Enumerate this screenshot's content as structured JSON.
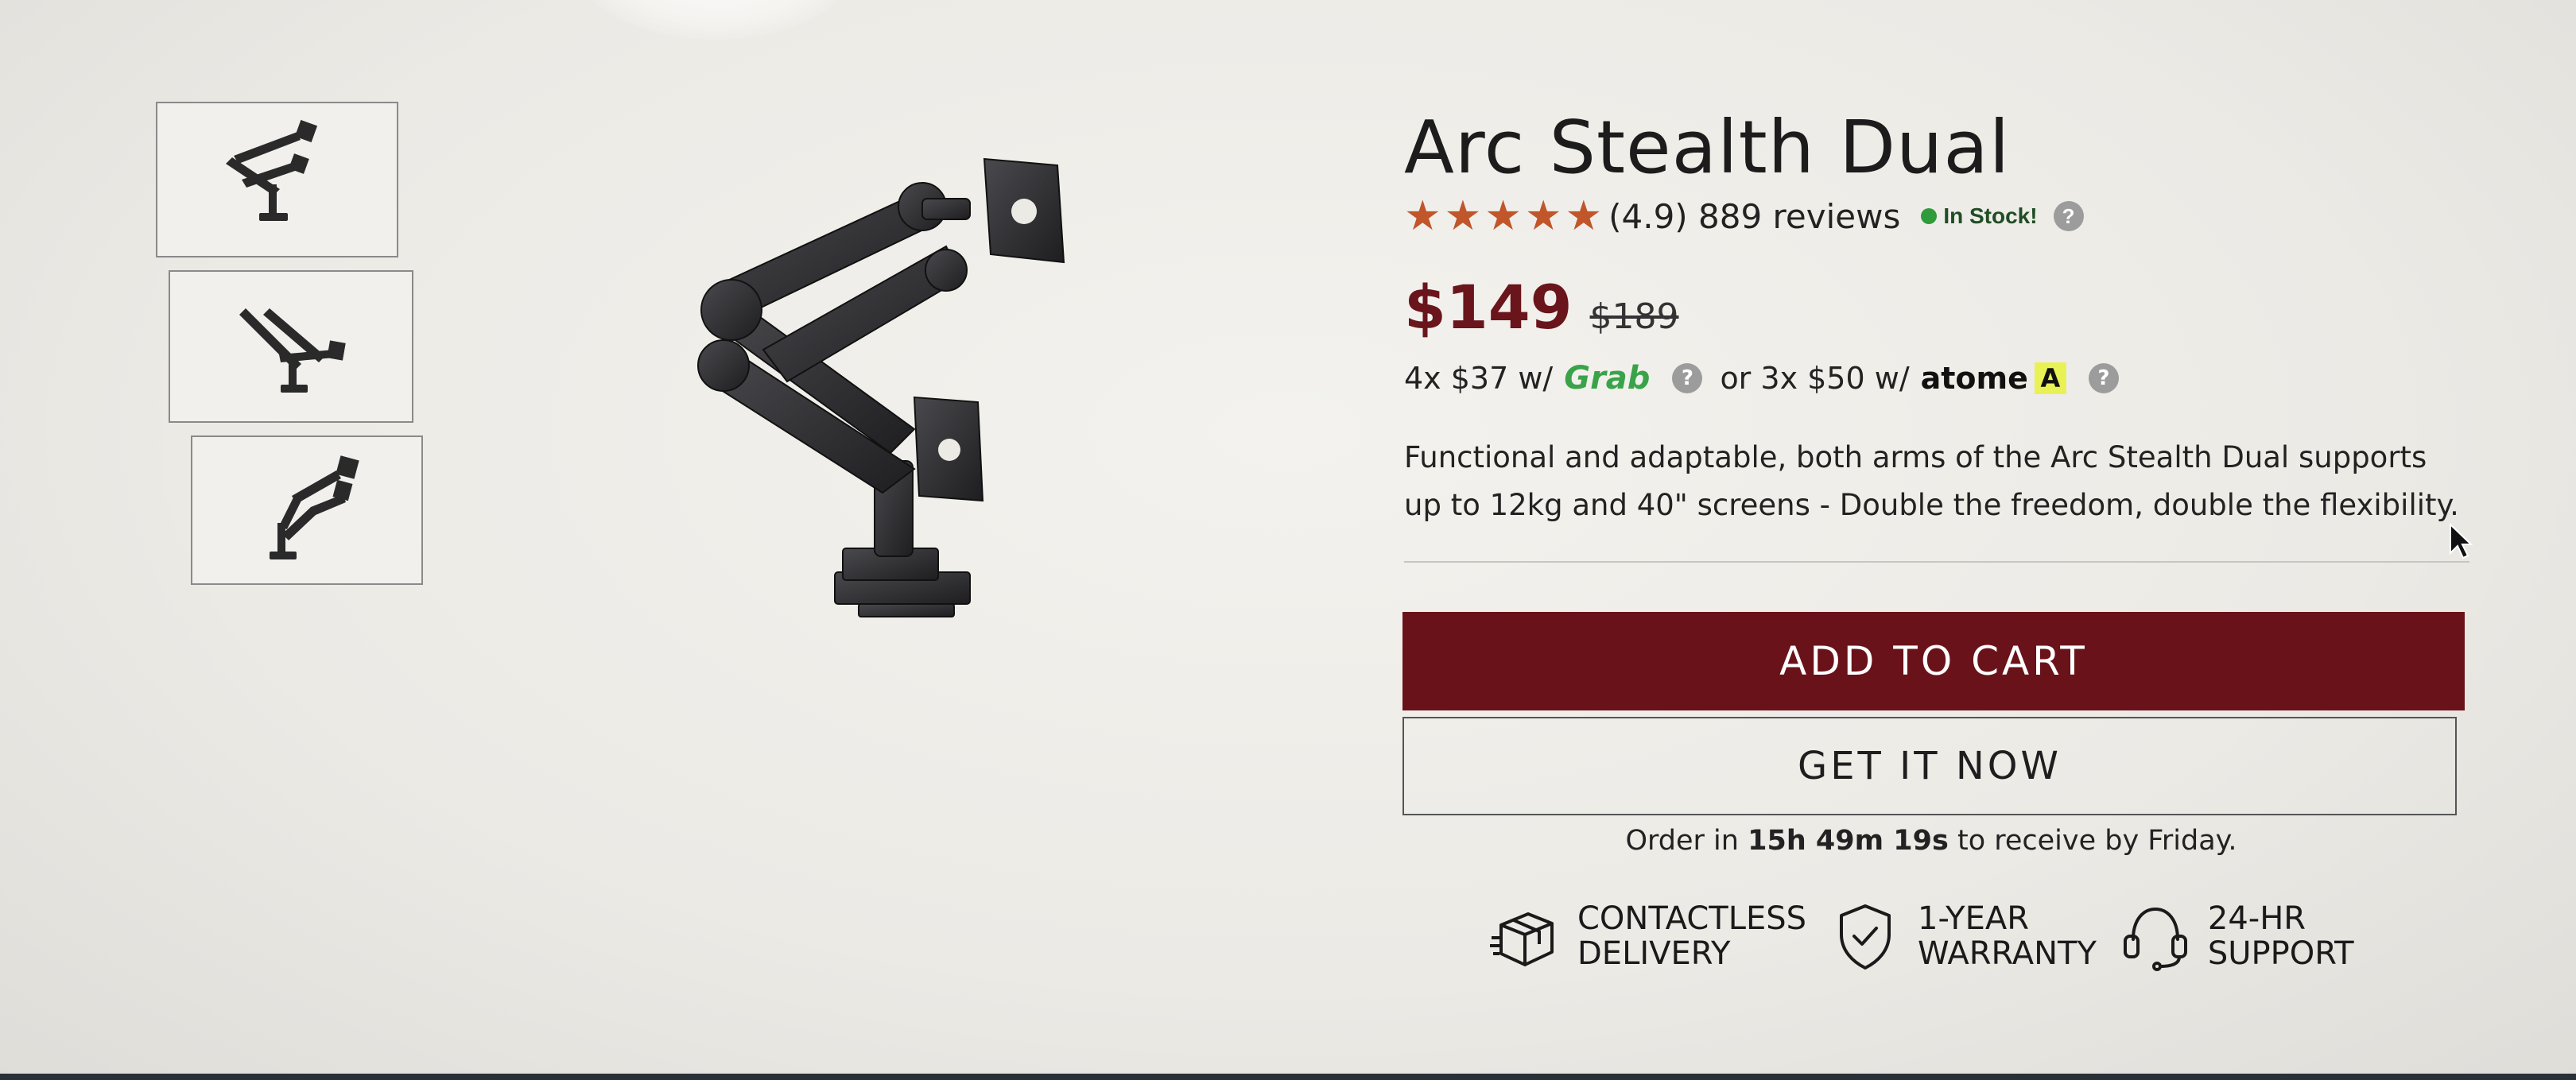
{
  "product": {
    "title": "Arc Stealth Dual",
    "rating_value": 4.9,
    "rating_text": "(4.9) 889 reviews",
    "stock": "In Stock!",
    "price": "$149",
    "old_price": "$189",
    "description": "Functional and adaptable, both arms of the Arc Stealth Dual supports up to 12kg and 40\" screens - Double the freedom, double the flexibility."
  },
  "installments": {
    "grab_text": "4x $37 w/",
    "grab_brand": "Grab",
    "separator": "or 3x $50 w/",
    "atome_brand": "atome",
    "atome_badge": "A"
  },
  "help_glyph": "?",
  "actions": {
    "add_to_cart": "ADD TO CART",
    "get_it_now": "GET IT NOW"
  },
  "order": {
    "prefix": "Order in",
    "countdown": "15h 49m 19s",
    "suffix": "to receive by Friday."
  },
  "features": [
    {
      "line1": "CONTACTLESS",
      "line2": "DELIVERY",
      "icon": "box-icon"
    },
    {
      "line1": "1-YEAR",
      "line2": "WARRANTY",
      "icon": "shield-check-icon"
    },
    {
      "line1": "24-HR",
      "line2": "SUPPORT",
      "icon": "headset-icon"
    }
  ],
  "thumbnails": [
    "monitor-arm-thumb-1",
    "monitor-arm-thumb-2",
    "monitor-arm-thumb-3"
  ],
  "colors": {
    "accent": "#6a1219",
    "price": "#6a141c",
    "star": "#c0562a",
    "stock": "#2f9b3a",
    "grab": "#3aa34a",
    "atome_badge": "#e9f255"
  }
}
